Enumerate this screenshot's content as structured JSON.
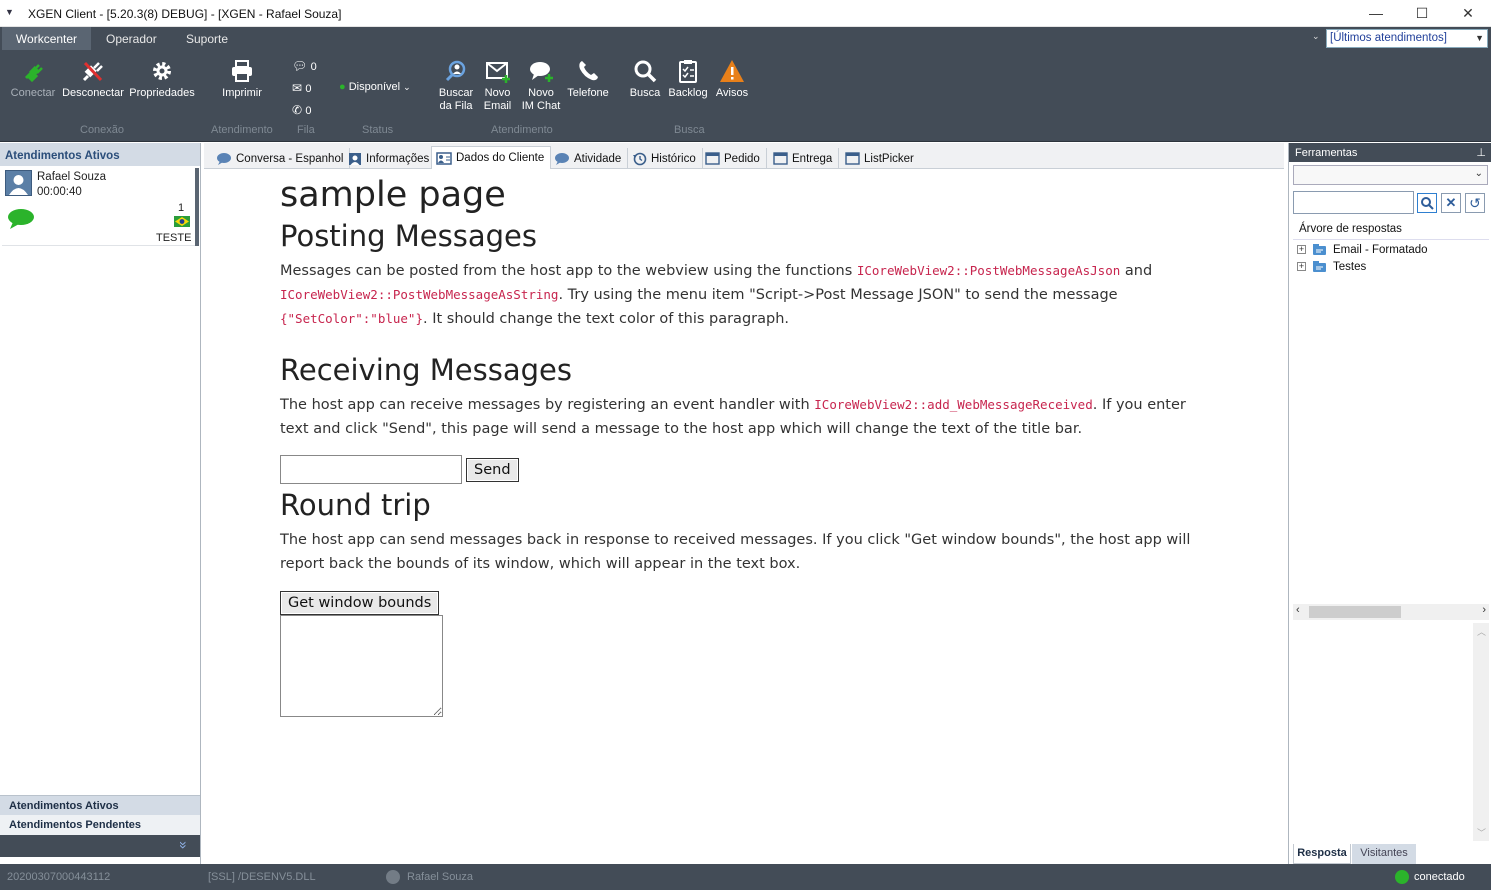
{
  "window": {
    "title": "XGEN Client - [5.20.3(8) DEBUG] - [XGEN - Rafael Souza]",
    "minimize": "—",
    "maximize": "☐",
    "close": "✕"
  },
  "menu": {
    "tabs": [
      "Workcenter",
      "Operador",
      "Suporte"
    ],
    "recent_dropdown": "[Últimos atendimentos]"
  },
  "ribbon": {
    "conectar": "Conectar",
    "desconectar": "Desconectar",
    "propriedades": "Propriedades",
    "imprimir": "Imprimir",
    "fila_counts": [
      "0",
      "0",
      "0"
    ],
    "status_value": "Disponível",
    "buscar_fila": [
      "Buscar",
      "da Fila"
    ],
    "novo_email": [
      "Novo",
      "Email"
    ],
    "novo_im": [
      "Novo",
      "IM Chat"
    ],
    "telefone": "Telefone",
    "busca": "Busca",
    "backlog": "Backlog",
    "avisos": "Avisos",
    "groups": {
      "conexao": "Conexão",
      "atendimento": "Atendimento",
      "fila": "Fila",
      "status": "Status",
      "atendimento2": "Atendimento",
      "busca": "Busca"
    }
  },
  "left_panel": {
    "header": "Atendimentos Ativos",
    "item": {
      "name": "Rafael Souza",
      "time": "00:00:40",
      "count": "1",
      "tag": "TESTE"
    },
    "bottom_tabs": [
      "Atendimentos Ativos",
      "Atendimentos Pendentes"
    ],
    "expand": "»"
  },
  "tabs": [
    "Conversa - Espanhol",
    "Informações",
    "Dados do Cliente",
    "Atividade",
    "Histórico",
    "Pedido",
    "Entrega",
    "ListPicker"
  ],
  "webview": {
    "h1": "sample page",
    "h2_posting": "Posting Messages",
    "p1_a": "Messages can be posted from the host app to the webview using the functions ",
    "p1_code1": "ICoreWebView2::PostWebMessageAsJson",
    "p1_b": " and ",
    "p1_code2": "ICoreWebView2::PostWebMessageAsString",
    "p1_c": ". Try using the menu item \"Script->Post Message JSON\" to send the message ",
    "p1_code3": "{\"SetColor\":\"blue\"}",
    "p1_d": ". It should change the text color of this paragraph.",
    "h2_receiving": "Receiving Messages",
    "p2_a": "The host app can receive messages by registering an event handler with ",
    "p2_code": "ICoreWebView2::add_WebMessageReceived",
    "p2_b": ". If you enter text and click \"Send\", this page will send a message to the host app which will change the text of the title bar.",
    "input_value": "",
    "send_label": "Send",
    "h2_round": "Round trip",
    "p3": "The host app can send messages back in response to received messages. If you click \"Get window bounds\", the host app will report back the bounds of its window, which will appear in the text box.",
    "bounds_label": "Get window bounds",
    "textarea_value": ""
  },
  "right_panel": {
    "header": "Ferramentas",
    "pin": "⊥",
    "tree_header": "Árvore de respostas",
    "tree_items": [
      "Email - Formatado",
      "Testes"
    ],
    "bottom_tabs": [
      "Resposta",
      "Visitantes"
    ]
  },
  "status_bar": {
    "id": "20200307000443112",
    "dll": "[SSL] /DESENV5.DLL",
    "user": "Rafael Souza",
    "state": "conectado"
  },
  "colors": {
    "ribbon_bg": "#434c57",
    "accent_green": "#2bb32b",
    "warning": "#e8801a",
    "code_pink": "#c7254e"
  }
}
